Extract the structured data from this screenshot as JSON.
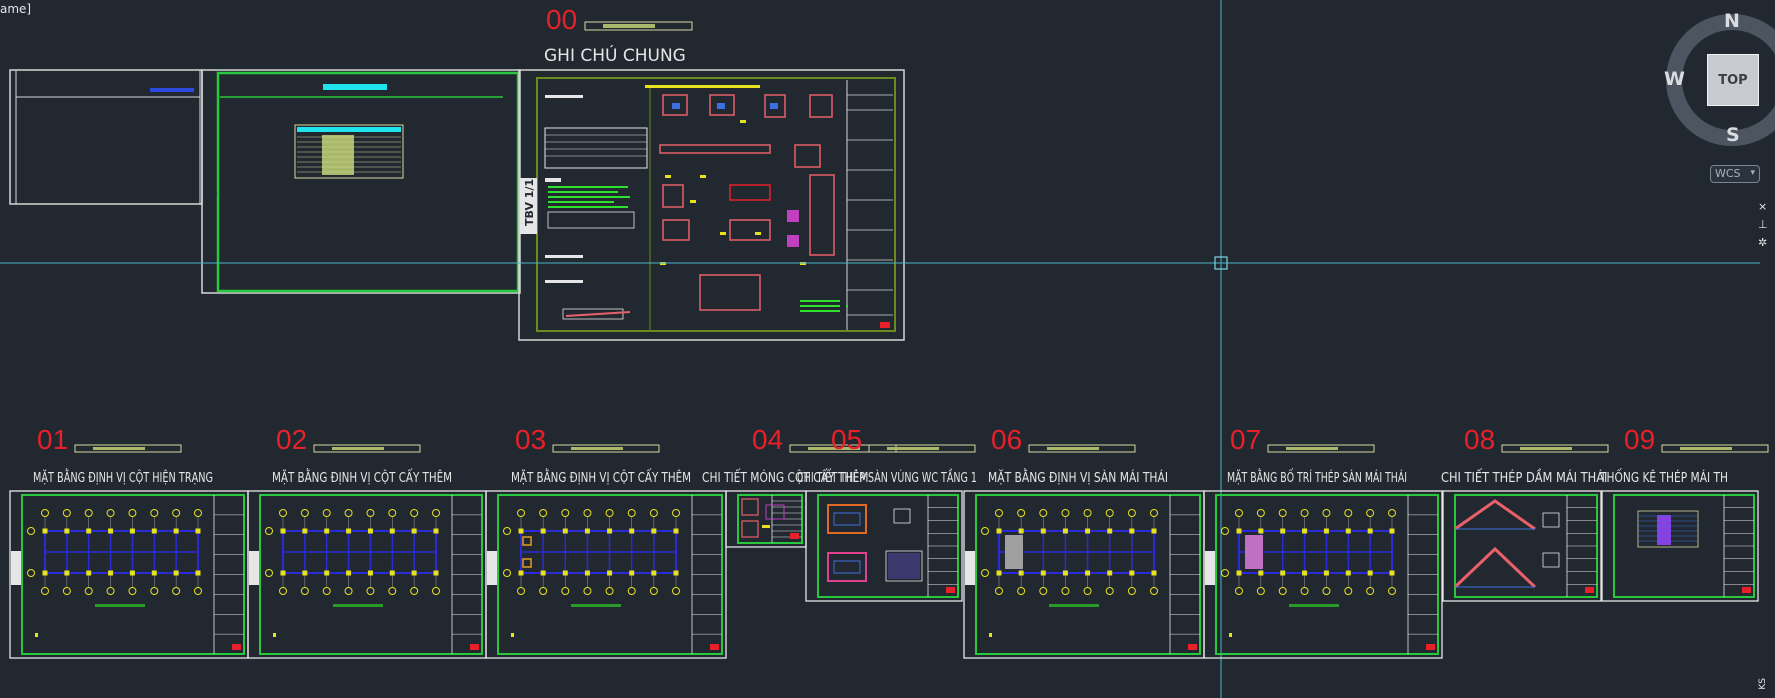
{
  "window": {
    "file_name": "ame]"
  },
  "viewcube": {
    "north": "N",
    "west": "W",
    "south": "S",
    "top": "TOP"
  },
  "wcs": {
    "label": "WCS",
    "caret": "▾"
  },
  "side_tools": {
    "close": "×",
    "pin": "⊥",
    "settings": "✲",
    "bottom": "KS"
  },
  "sheet_labels": {
    "overview_left": "TBV 1/18",
    "general_notes": "TBV 1/18"
  },
  "general_notes": {
    "number": "00",
    "title": "GHI CHÚ CHUNG"
  },
  "sheets": [
    {
      "number": "01",
      "title": "MẶT BẰNG ĐỊNH VỊ CỘT HIỆN TRẠNG"
    },
    {
      "number": "02",
      "title": "MẶT BẰNG ĐỊNH VỊ CỘT CẤY THÊM"
    },
    {
      "number": "03",
      "title": "MẶT BẰNG ĐỊNH VỊ CỘT CẤY THÊM"
    },
    {
      "number": "04",
      "title": "CHI TIẾT MÓNG CỘT CẤY THÊM"
    },
    {
      "number": "05",
      "title": "CHI TIẾT THÉP SÀN VÙNG WC TẦNG 1"
    },
    {
      "number": "06",
      "title": "MẶT BẰNG ĐỊNH VỊ SÀN MÁI THÁI"
    },
    {
      "number": "07",
      "title": "MẶT BẰNG BỐ TRÍ THÉP SÀN MÁI THÁI"
    },
    {
      "number": "08",
      "title": "CHI TIẾT THÉP DẦM MÁI THÁI"
    },
    {
      "number": "09",
      "title": "THỐNG KÊ THÉP MÁI TH"
    }
  ],
  "colors": {
    "background": "#212830",
    "sheet_number": "#e8202a",
    "sheet_border": "#e6e6e6",
    "inner_frame": "#28c83c",
    "grid_blue": "#2a2ad8",
    "marker_yellow": "#e6e21e",
    "crosshair": "#4ab3c9"
  }
}
